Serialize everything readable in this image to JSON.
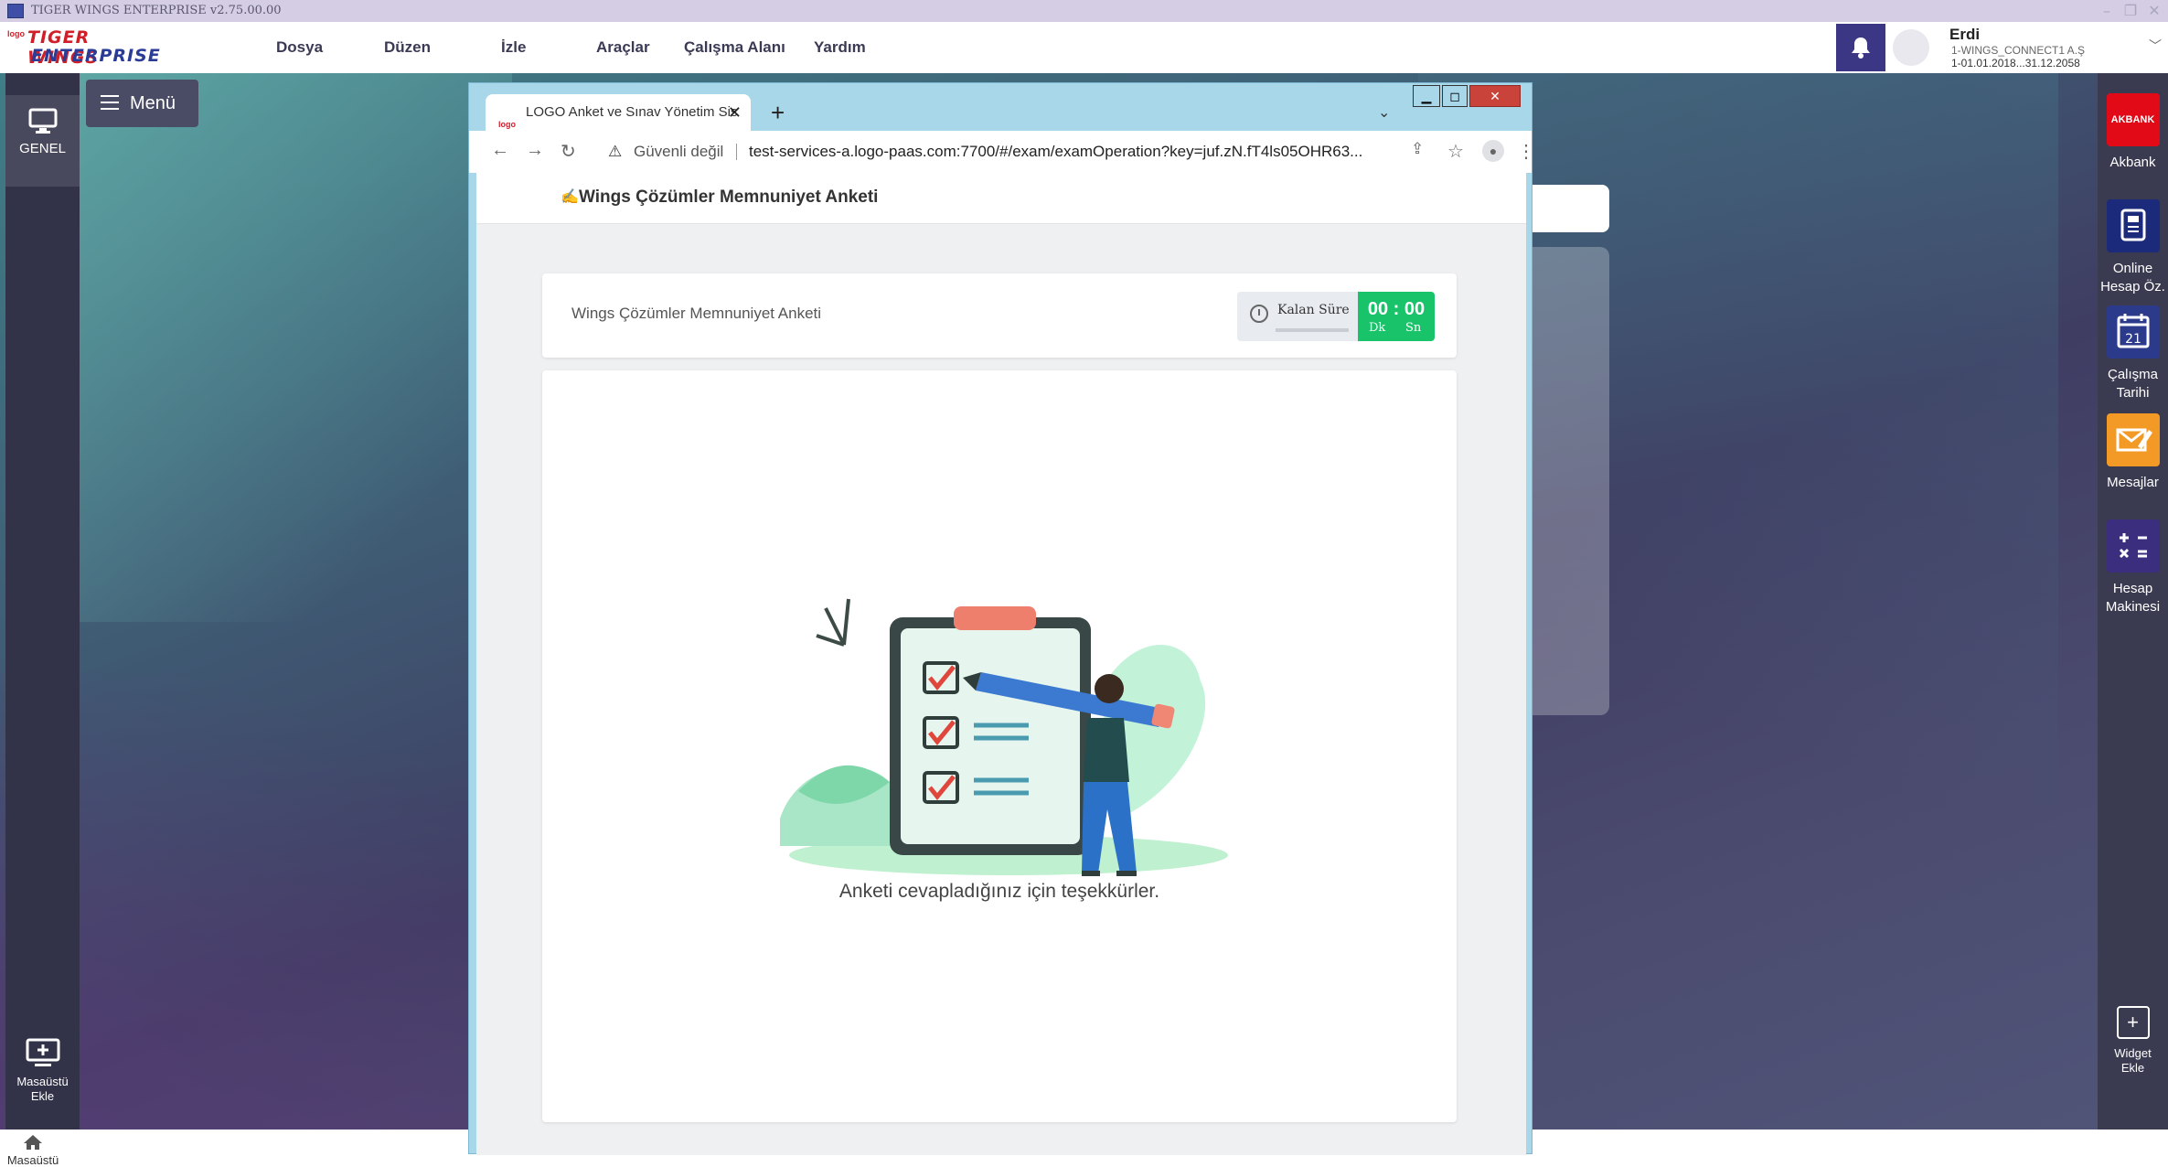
{
  "window": {
    "title": "TIGER WINGS ENTERPRISE v2.75.00.00"
  },
  "logo": {
    "small": "logo",
    "line1": "TIGER WINGS",
    "line2": "ENTERPRISE"
  },
  "menu": {
    "dosya": "Dosya",
    "duzen": "Düzen",
    "izle": "İzle",
    "araclar": "Araçlar",
    "calisma_alani": "Çalışma Alanı",
    "yardim": "Yardım"
  },
  "user": {
    "name": "Erdi",
    "company": "1-WINGS_CONNECT1 A.Ş",
    "period": "1-01.01.2018...31.12.2058"
  },
  "sidebar": {
    "genel": "GENEL",
    "menu_btn": "Menü",
    "desktop_add_1": "Masaüstü",
    "desktop_add_2": "Ekle",
    "home": "Masaüstü"
  },
  "rightbar": {
    "akbank_logo": "AKBANK",
    "akbank": "Akbank",
    "online_1": "Online",
    "online_2": "Hesap Öz.",
    "calendar_day": "21",
    "calisma_1": "Çalışma",
    "calisma_2": "Tarihi",
    "mesajlar": "Mesajlar",
    "hesap_1": "Hesap",
    "hesap_2": "Makinesi",
    "widget_1": "Widget",
    "widget_2": "Ekle"
  },
  "browser": {
    "tab_title": "LOGO Anket ve Sınav Yönetim Sis",
    "tab_favicon": "logo",
    "security": "Güvenli değil",
    "url": "test-services-a.logo-paas.com:7700/#/exam/examOperation?key=juf.zN.fT4ls05OHR63..."
  },
  "page": {
    "header_title": "Wings Çözümler Memnuniyet Anketi",
    "card_title": "Wings Çözümler Memnuniyet Anketi",
    "timer_label": "Kalan Süre",
    "timer_value": "00 : 00",
    "timer_unit_min": "Dk",
    "timer_unit_sec": "Sn",
    "thanks": "Anketi cevapladığınız için teşekkürler."
  },
  "colors": {
    "accent_green": "#19c36a",
    "notify_bg": "#3b3784",
    "brand_red": "#d11f2a",
    "brand_blue": "#2b3c96"
  }
}
